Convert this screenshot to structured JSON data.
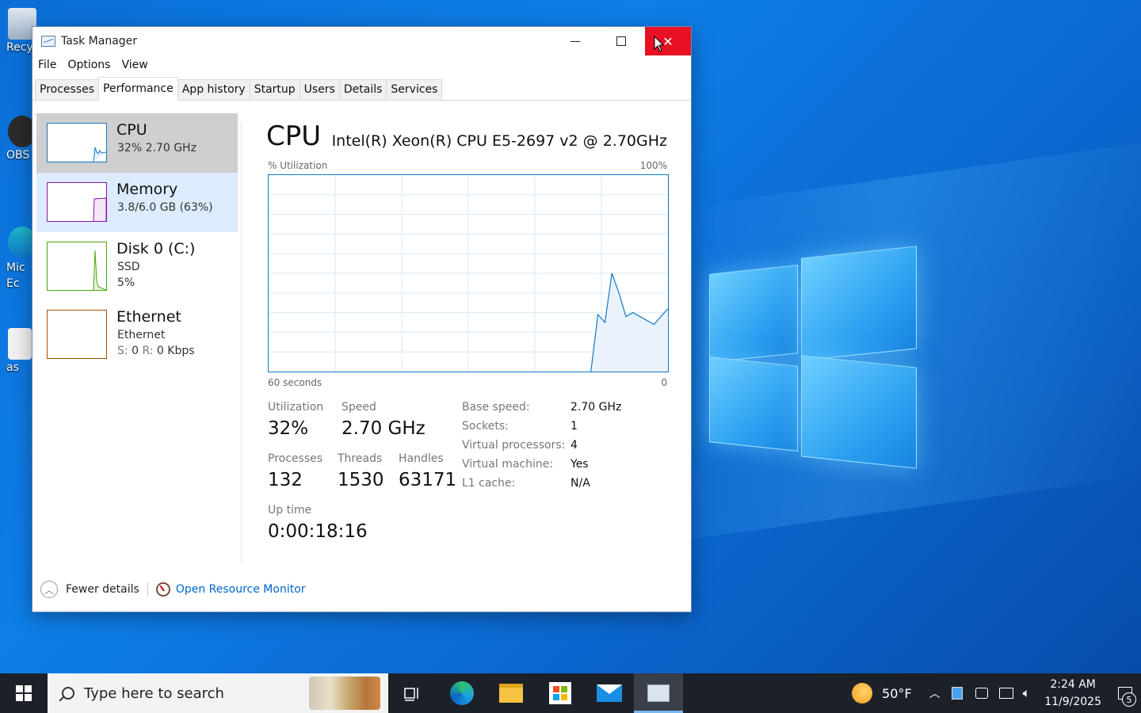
{
  "desktop": {
    "icons": [
      {
        "label": "Recy"
      },
      {
        "label": "OBS"
      },
      {
        "label": "Mic\nEc"
      },
      {
        "label": "as"
      }
    ]
  },
  "window": {
    "title": "Task Manager",
    "menu": [
      "File",
      "Options",
      "View"
    ],
    "tabs": [
      "Processes",
      "Performance",
      "App history",
      "Startup",
      "Users",
      "Details",
      "Services"
    ],
    "active_tab": "Performance"
  },
  "resources": [
    {
      "name": "CPU",
      "sub1": "32%  2.70 GHz",
      "color": "#1179c6"
    },
    {
      "name": "Memory",
      "sub1": "3.8/6.0 GB (63%)",
      "color": "#8b12ae"
    },
    {
      "name": "Disk 0 (C:)",
      "sub1": "SSD",
      "sub2": "5%",
      "color": "#4da60c"
    },
    {
      "name": "Ethernet",
      "sub1": "Ethernet",
      "sub2_s": "S:",
      "sub2_sv": "0",
      "sub2_r": "R:",
      "sub2_rv": "0 Kbps",
      "color": "#a74f01"
    }
  ],
  "detail": {
    "title": "CPU",
    "model": "Intel(R) Xeon(R) CPU E5-2697 v2 @ 2.70GHz",
    "graph_top_left": "% Utilization",
    "graph_top_right": "100%",
    "graph_bottom_left": "60 seconds",
    "graph_bottom_right": "0",
    "utilization_label": "Utilization",
    "utilization": "32%",
    "speed_label": "Speed",
    "speed": "2.70 GHz",
    "processes_label": "Processes",
    "processes": "132",
    "threads_label": "Threads",
    "threads": "1530",
    "handles_label": "Handles",
    "handles": "63171",
    "uptime_label": "Up time",
    "uptime": "0:00:18:16",
    "specs": [
      {
        "k": "Base speed:",
        "v": "2.70 GHz"
      },
      {
        "k": "Sockets:",
        "v": "1"
      },
      {
        "k": "Virtual processors:",
        "v": "4"
      },
      {
        "k": "Virtual machine:",
        "v": "Yes"
      },
      {
        "k": "L1 cache:",
        "v": "N/A"
      }
    ]
  },
  "footer": {
    "fewer": "Fewer details",
    "resmon": "Open Resource Monitor"
  },
  "taskbar": {
    "search_placeholder": "Type here to search",
    "weather": "50°F",
    "time": "2:24 AM",
    "date": "11/9/2025",
    "notifications": "5"
  },
  "cpu_series": [
    0,
    0,
    0,
    0,
    0,
    0,
    0,
    0,
    0,
    0,
    0,
    0,
    0,
    0,
    0,
    0,
    0,
    0,
    0,
    0,
    0,
    0,
    0,
    0,
    0,
    0,
    0,
    0,
    0,
    0,
    0,
    0,
    0,
    0,
    0,
    0,
    0,
    0,
    0,
    0,
    0,
    0,
    0,
    0,
    0,
    0,
    0,
    29,
    25,
    50,
    40,
    28,
    30,
    28,
    26,
    24,
    28,
    32
  ]
}
